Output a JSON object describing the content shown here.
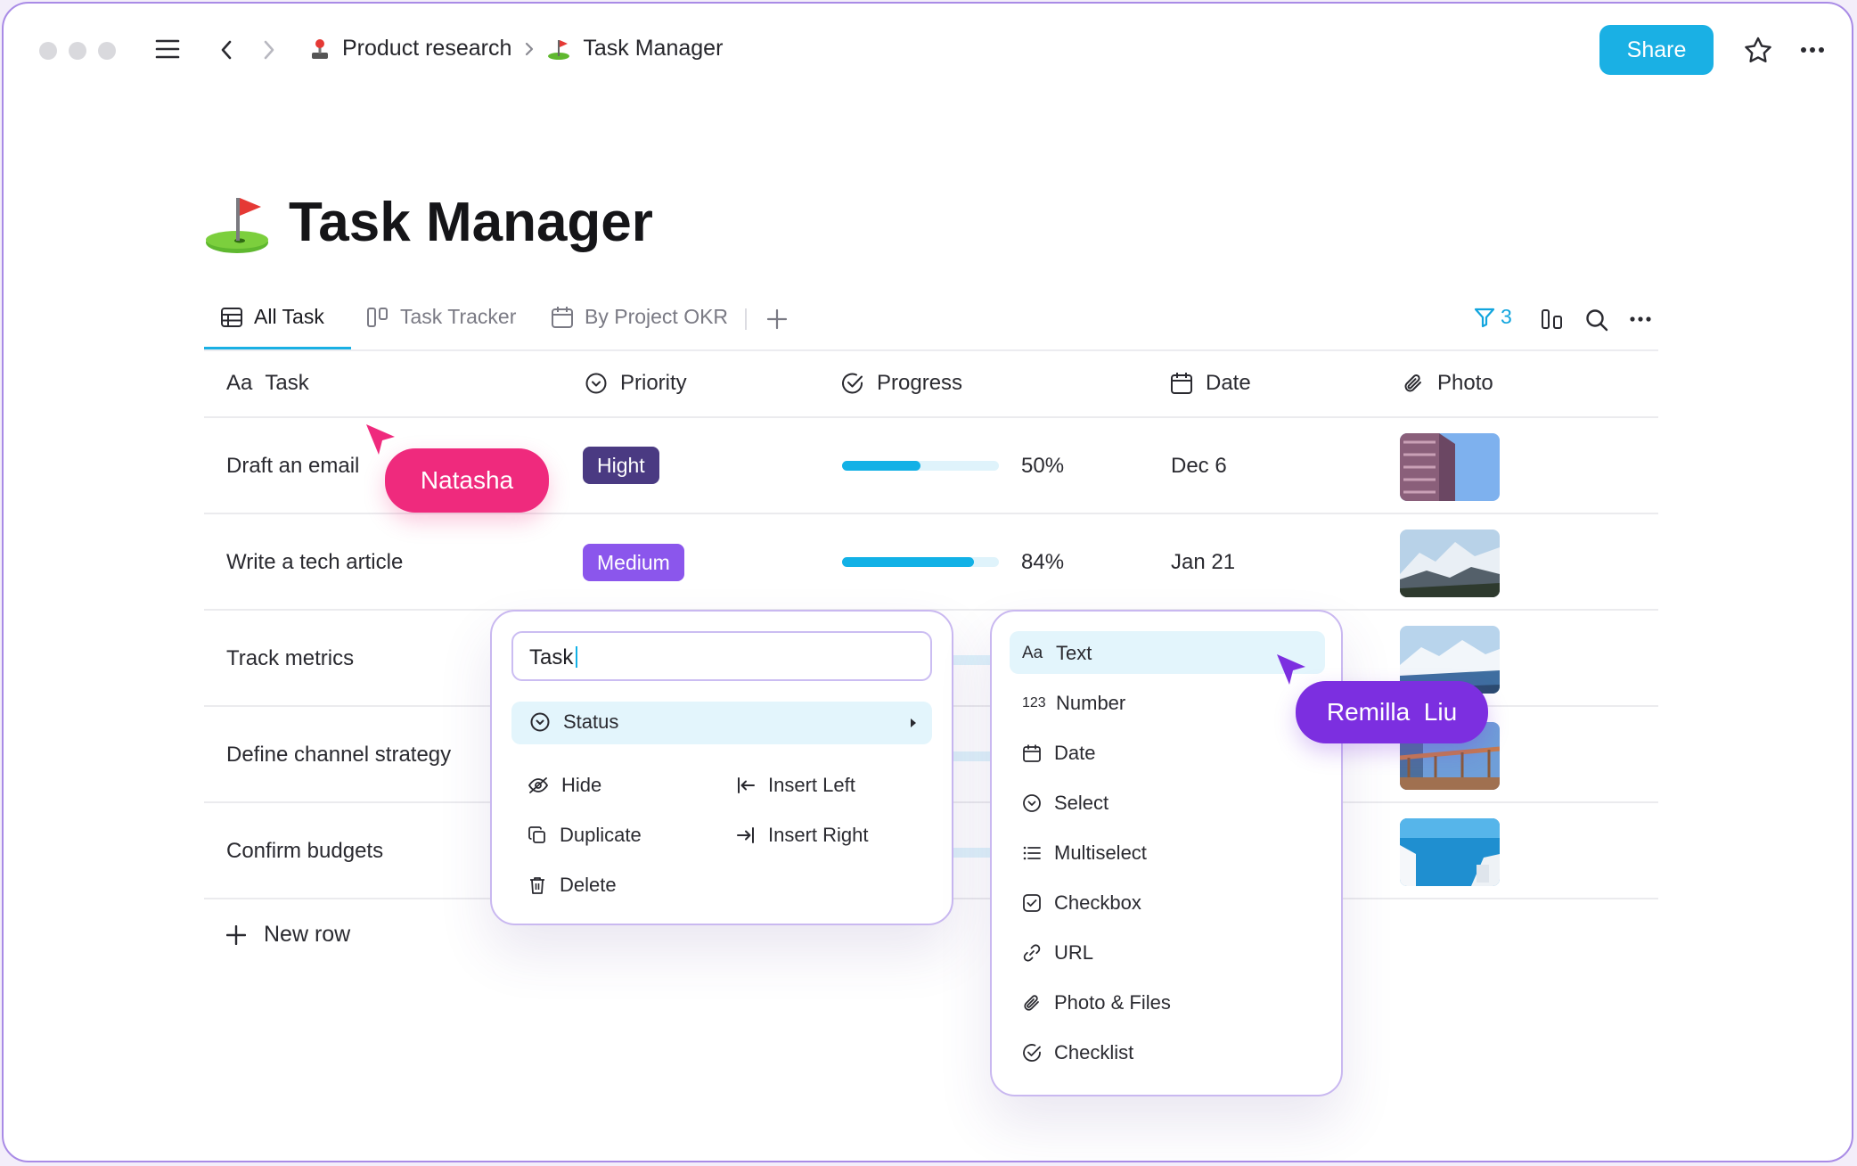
{
  "colors": {
    "accent": "#1ab0e4",
    "badge_high": "#4a3a82",
    "badge_medium": "#8b56ec",
    "cursor_natasha": "#ef2a7d",
    "cursor_remilla": "#7c2fe0"
  },
  "toolbar": {
    "breadcrumb_parent": "Product research",
    "breadcrumb_current": "Task Manager",
    "share_label": "Share"
  },
  "page": {
    "title": "Task Manager"
  },
  "tabs": [
    {
      "label": "All Task",
      "icon": "table-icon",
      "active": true
    },
    {
      "label": "Task Tracker",
      "icon": "board-icon",
      "active": false
    },
    {
      "label": "By Project OKR",
      "icon": "calendar-icon",
      "active": false
    }
  ],
  "view_tools": {
    "filter_count": "3"
  },
  "columns": [
    {
      "label": "Task",
      "icon": "text-type-icon"
    },
    {
      "label": "Priority",
      "icon": "select-icon"
    },
    {
      "label": "Progress",
      "icon": "check-circle-icon"
    },
    {
      "label": "Date",
      "icon": "calendar-icon"
    },
    {
      "label": "Photo",
      "icon": "paperclip-icon"
    }
  ],
  "rows": [
    {
      "task": "Draft an email",
      "priority": "Hight",
      "progress": 0.5,
      "progress_label": "50%",
      "date": "Dec 6"
    },
    {
      "task": "Write a tech article",
      "priority": "Medium",
      "progress": 0.84,
      "progress_label": "84%",
      "date": "Jan 21"
    },
    {
      "task": "Track metrics"
    },
    {
      "task": "Define channel strategy"
    },
    {
      "task": "Confirm budgets"
    }
  ],
  "new_row_label": "New row",
  "column_menu": {
    "input_value": "Task",
    "type_label": "Status",
    "actions": {
      "hide": "Hide",
      "insert_left": "Insert Left",
      "duplicate": "Duplicate",
      "insert_right": "Insert Right",
      "delete": "Delete"
    }
  },
  "type_menu": {
    "items": [
      {
        "label": "Text",
        "icon": "text-type-icon",
        "highlighted": true
      },
      {
        "label": "Number",
        "icon": "number-icon"
      },
      {
        "label": "Date",
        "icon": "calendar-icon"
      },
      {
        "label": "Select",
        "icon": "select-icon"
      },
      {
        "label": "Multiselect",
        "icon": "list-icon"
      },
      {
        "label": "Checkbox",
        "icon": "checkbox-icon"
      },
      {
        "label": "URL",
        "icon": "link-icon"
      },
      {
        "label": "Photo & Files",
        "icon": "paperclip-icon"
      },
      {
        "label": "Checklist",
        "icon": "check-circle-icon"
      }
    ]
  },
  "collaborators": {
    "natasha": "Natasha",
    "remilla": "Remilla  Liu"
  }
}
